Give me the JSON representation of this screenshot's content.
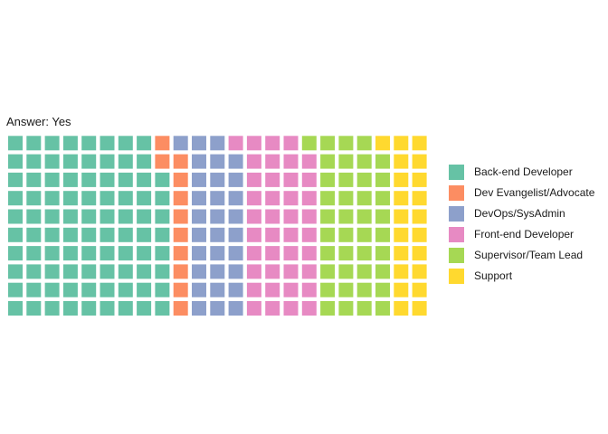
{
  "chart_data": {
    "type": "waffle",
    "title": "Answer: Yes",
    "rows": 10,
    "fill_order": "column-major, bottom to top",
    "legend_position": "right",
    "categories": [
      {
        "name": "Back-end Developer",
        "count": 88,
        "color": "#66C2A5"
      },
      {
        "name": "Dev Evangelist/Advocate",
        "count": 11,
        "color": "#FC8D62"
      },
      {
        "name": "DevOps/SysAdmin",
        "count": 30,
        "color": "#8DA0CB"
      },
      {
        "name": "Front-end Developer",
        "count": 40,
        "color": "#E78AC3"
      },
      {
        "name": "Supervisor/Team Lead",
        "count": 40,
        "color": "#A6D854"
      },
      {
        "name": "Support",
        "count": 21,
        "color": "#FFD92F"
      }
    ]
  }
}
